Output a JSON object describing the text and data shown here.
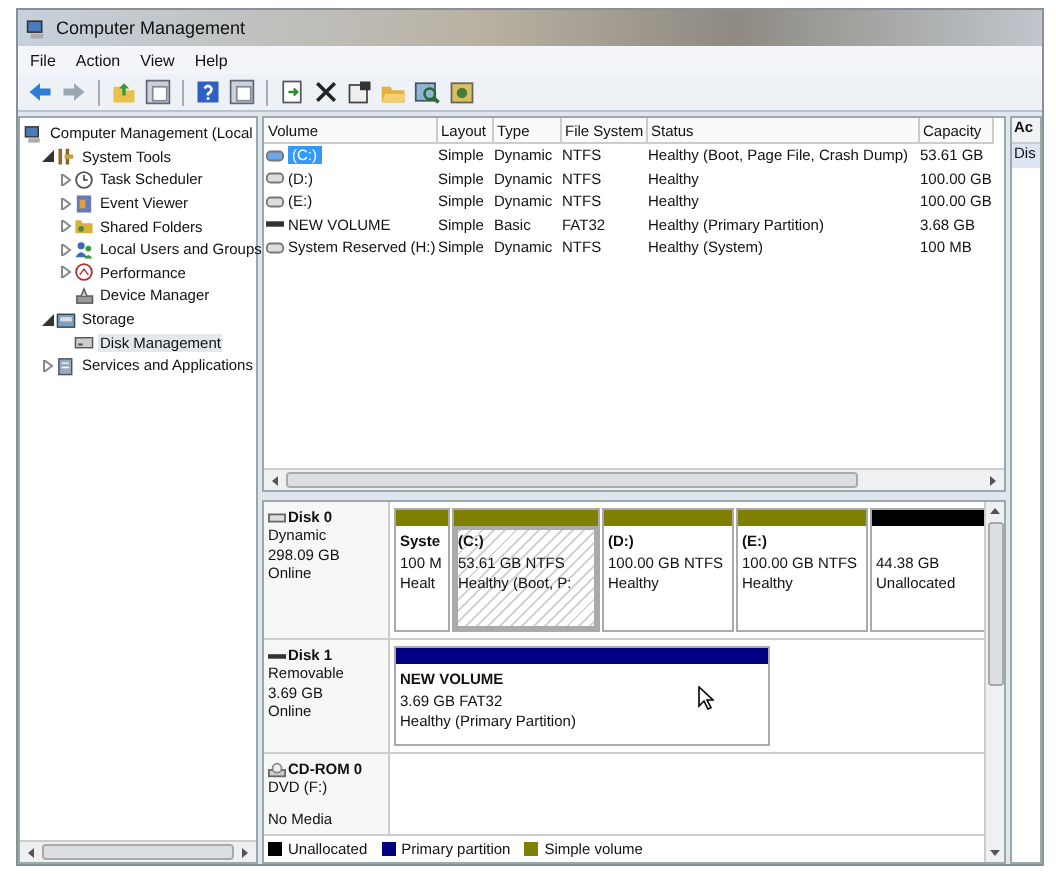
{
  "window": {
    "title": "Computer Management"
  },
  "menu": [
    "File",
    "Action",
    "View",
    "Help"
  ],
  "tree": [
    {
      "label": "Computer Management (Local",
      "selected": false,
      "children": [
        {
          "label": "System Tools",
          "expanded": true,
          "selected": false,
          "children": [
            {
              "label": "Task Scheduler",
              "expanded": false,
              "selected": false
            },
            {
              "label": "Event Viewer",
              "expanded": false,
              "selected": false
            },
            {
              "label": "Shared Folders",
              "expanded": false,
              "selected": false
            },
            {
              "label": "Local Users and Groups",
              "expanded": false,
              "selected": false
            },
            {
              "label": "Performance",
              "expanded": false,
              "selected": false
            },
            {
              "label": "Device Manager",
              "selected": false
            }
          ]
        },
        {
          "label": "Storage",
          "expanded": true,
          "selected": false,
          "children": [
            {
              "label": "Disk Management",
              "selected": true
            }
          ]
        },
        {
          "label": "Services and Applications",
          "expanded": false,
          "selected": false
        }
      ]
    }
  ],
  "table": {
    "columns": [
      "Volume",
      "Layout",
      "Type",
      "File System",
      "Status",
      "Capacity"
    ],
    "rows": [
      {
        "kind": "fixed",
        "selected": true,
        "cells": [
          "(C:)",
          "Simple",
          "Dynamic",
          "NTFS",
          "Healthy (Boot, Page File, Crash Dump)",
          "53.61 GB"
        ]
      },
      {
        "kind": "fixed",
        "selected": false,
        "cells": [
          "(D:)",
          "Simple",
          "Dynamic",
          "NTFS",
          "Healthy",
          "100.00 GB"
        ]
      },
      {
        "kind": "fixed",
        "selected": false,
        "cells": [
          "(E:)",
          "Simple",
          "Dynamic",
          "NTFS",
          "Healthy",
          "100.00 GB"
        ]
      },
      {
        "kind": "removable",
        "selected": false,
        "cells": [
          "NEW VOLUME",
          "Simple",
          "Basic",
          "FAT32",
          "Healthy (Primary Partition)",
          "3.68 GB"
        ]
      },
      {
        "kind": "fixed",
        "selected": false,
        "cells": [
          "System Reserved (H:)",
          "Simple",
          "Dynamic",
          "NTFS",
          "Healthy (System)",
          "100 MB"
        ]
      }
    ]
  },
  "disks": [
    {
      "kind": "hard",
      "name": "Disk 0",
      "type": "Dynamic",
      "size": "298.09 GB",
      "status": "Online",
      "partitions": [
        {
          "name": "Syste",
          "size": "100 M",
          "status": "Healt",
          "color": "#808000",
          "selected": false
        },
        {
          "name": "(C:)",
          "size": "53.61 GB NTFS",
          "status": "Healthy (Boot, P:",
          "color": "#808000",
          "selected": true
        },
        {
          "name": "(D:)",
          "size": "100.00 GB NTFS",
          "status": "Healthy",
          "color": "#808000",
          "selected": false
        },
        {
          "name": "(E:)",
          "size": "100.00 GB NTFS",
          "status": "Healthy",
          "color": "#808000",
          "selected": false
        },
        {
          "size": "44.38 GB",
          "status": "Unallocated",
          "color": "#000000",
          "selected": false
        }
      ]
    },
    {
      "kind": "removable",
      "name": "Disk 1",
      "type": "Removable",
      "size": "3.69 GB",
      "status": "Online",
      "partitions": [
        {
          "name": "NEW VOLUME",
          "size": "3.69 GB FAT32",
          "status": "Healthy (Primary Partition)",
          "color": "#000080",
          "selected": false
        }
      ]
    },
    {
      "kind": "cdrom",
      "name": "CD-ROM 0",
      "type": "DVD (F:)",
      "status": "No Media"
    }
  ],
  "legend": [
    {
      "label": "Unallocated",
      "color": "#000000"
    },
    {
      "label": "Primary partition",
      "color": "#000080"
    },
    {
      "label": "Simple volume",
      "color": "#808000"
    }
  ],
  "actions": {
    "header": "Ac",
    "items": [
      {
        "label": "Dis",
        "selected": true
      }
    ]
  }
}
